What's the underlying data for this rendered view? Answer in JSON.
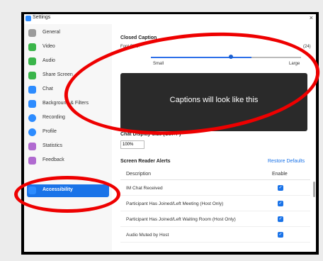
{
  "window": {
    "title": "Settings",
    "close_label": "×"
  },
  "sidebar": {
    "items": [
      {
        "label": "General",
        "color": "#9b9b9b"
      },
      {
        "label": "Video",
        "color": "#3ab54a"
      },
      {
        "label": "Audio",
        "color": "#3ab54a"
      },
      {
        "label": "Share Screen",
        "color": "#3ab54a"
      },
      {
        "label": "Chat",
        "color": "#2d8cff"
      },
      {
        "label": "Background & Filters",
        "color": "#2d8cff"
      },
      {
        "label": "Recording",
        "color": "#2d8cff"
      },
      {
        "label": "Profile",
        "color": "#2d8cff"
      },
      {
        "label": "Statistics",
        "color": "#b06ad0"
      },
      {
        "label": "Feedback",
        "color": "#b06ad0"
      },
      {
        "label": "Accessibility",
        "color": "#2d8cff"
      }
    ]
  },
  "closed_caption": {
    "title": "Closed Caption",
    "font_size_label": "Font Size:",
    "small_label": "Small",
    "large_label": "Large",
    "value_label": "(24)",
    "slider_fraction": 0.72,
    "preview_text": "Captions will look like this"
  },
  "chat_display": {
    "title": "Chat Display Size (Ctrl+/-)",
    "value": "100%"
  },
  "screen_reader": {
    "title": "Screen Reader Alerts",
    "restore_label": "Restore Defaults",
    "col_description": "Description",
    "col_enable": "Enable",
    "rows": [
      {
        "label": "IM Chat Received",
        "enabled": true
      },
      {
        "label": "Participant Has Joined/Left Meeting (Host Only)",
        "enabled": true
      },
      {
        "label": "Participant Has Joined/Left Waiting Room (Host Only)",
        "enabled": true
      },
      {
        "label": "Audio Muted by Host",
        "enabled": true
      }
    ]
  },
  "check_glyph": "✓"
}
